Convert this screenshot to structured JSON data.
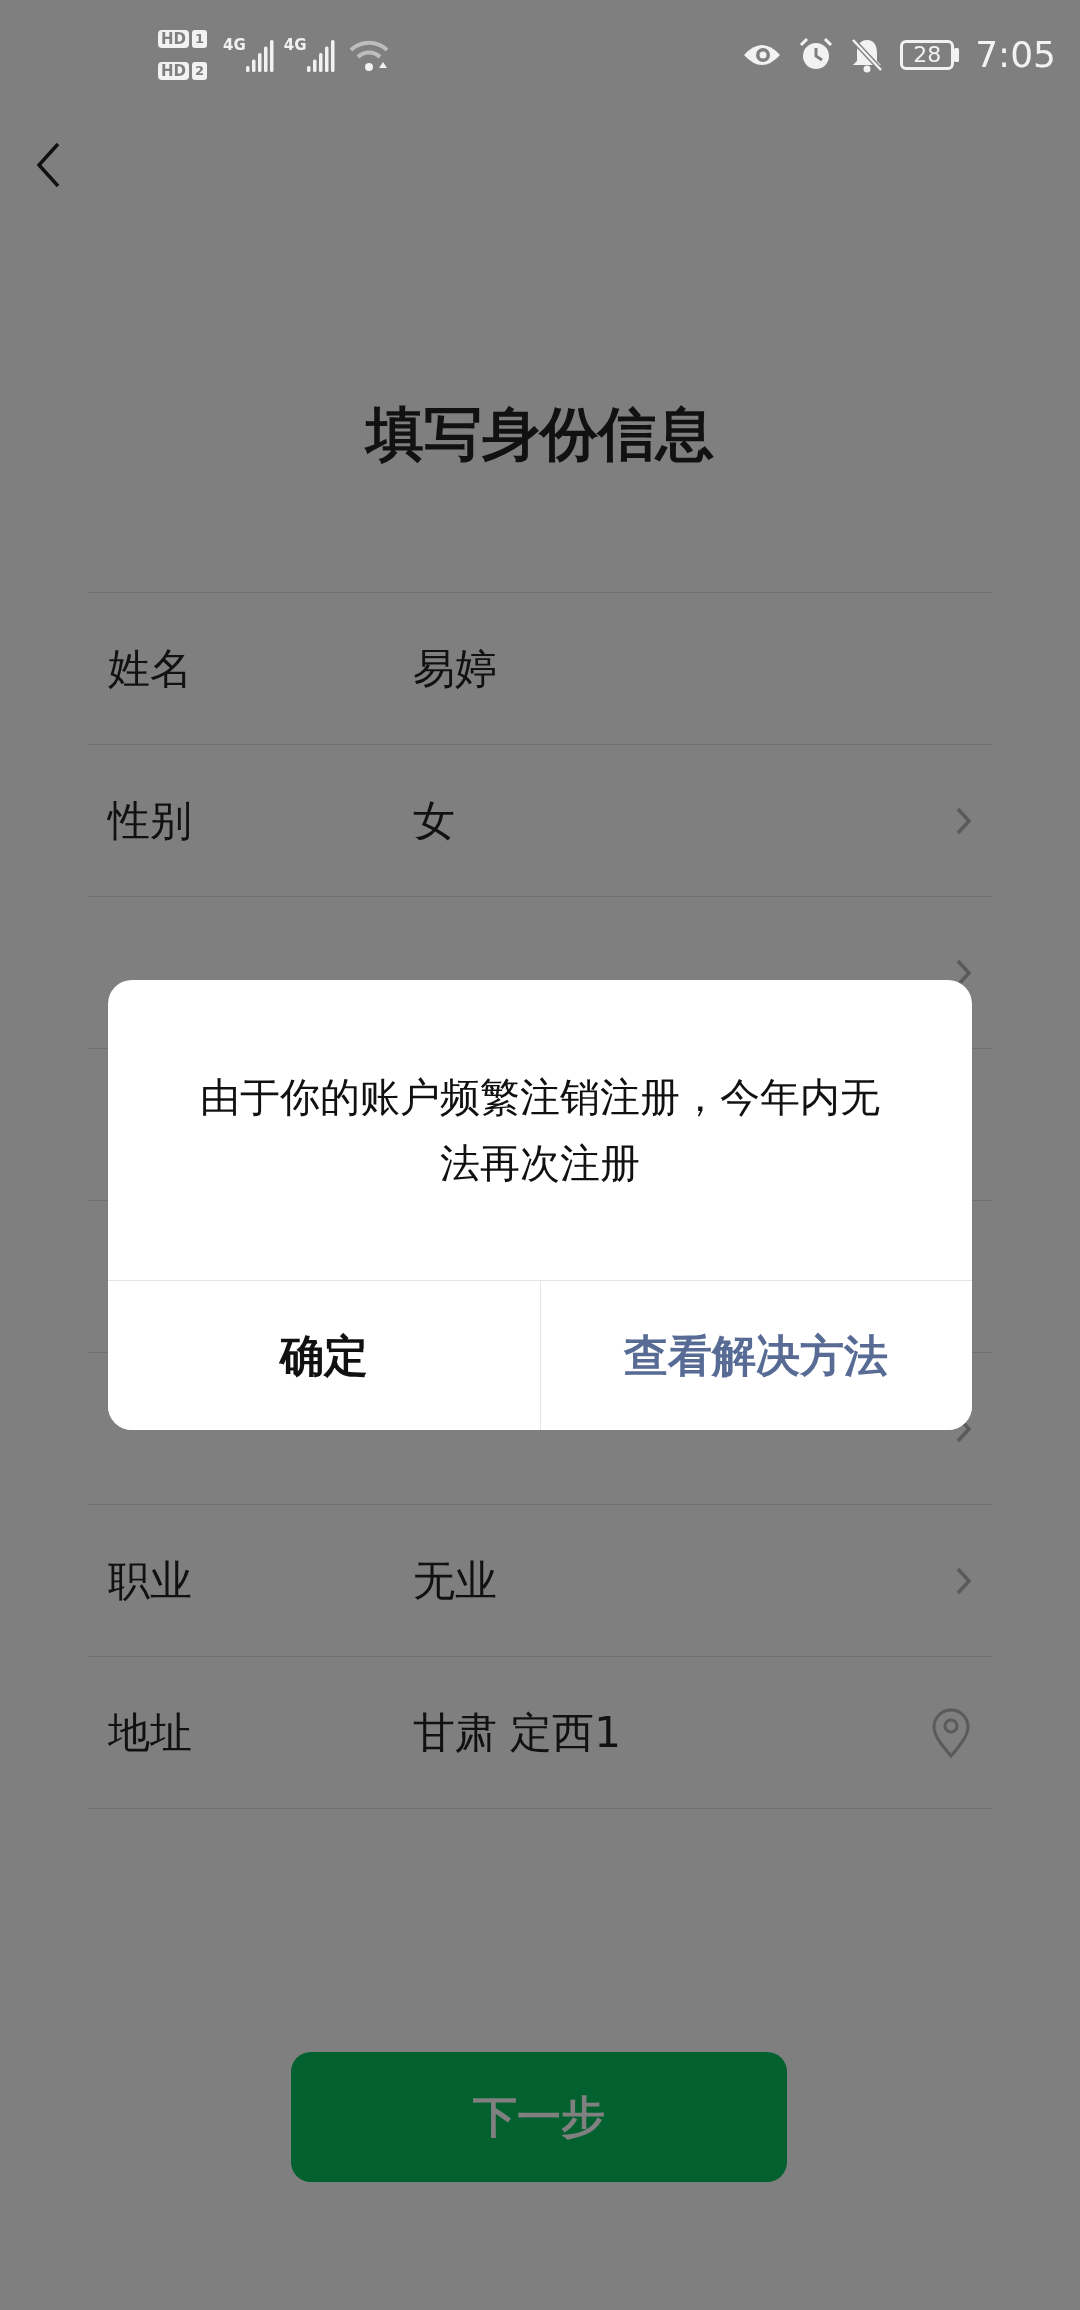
{
  "status_bar": {
    "sims": [
      {
        "hd": "HD",
        "slot": "1"
      },
      {
        "hd": "HD",
        "slot": "2"
      }
    ],
    "signals": [
      {
        "label": "4G"
      },
      {
        "label": "4G"
      }
    ],
    "battery": "28",
    "time": "7:05"
  },
  "title": "填写身份信息",
  "form": [
    {
      "kind": "field",
      "label": "姓名",
      "value": "易婷",
      "chevron": false,
      "location_pin": false
    },
    {
      "kind": "field",
      "label": "性别",
      "value": "女",
      "chevron": true,
      "location_pin": false
    },
    {
      "kind": "covered",
      "chevron": true,
      "location_pin": false
    },
    {
      "kind": "covered",
      "chevron": false,
      "location_pin": false
    },
    {
      "kind": "covered",
      "chevron": false,
      "location_pin": false
    },
    {
      "kind": "covered",
      "chevron": true,
      "location_pin": false
    },
    {
      "kind": "field",
      "label": "职业",
      "value": "无业",
      "chevron": true,
      "location_pin": false
    },
    {
      "kind": "field",
      "label": "地址",
      "value": "甘肃 定西1",
      "chevron": false,
      "location_pin": true
    }
  ],
  "next_button": "下一步",
  "dialog": {
    "message": "由于你的账户频繁注销注册，今年内无法再次注册",
    "buttons": [
      {
        "label": "确定",
        "kind": "default"
      },
      {
        "label": "查看解决方法",
        "kind": "link"
      }
    ]
  }
}
